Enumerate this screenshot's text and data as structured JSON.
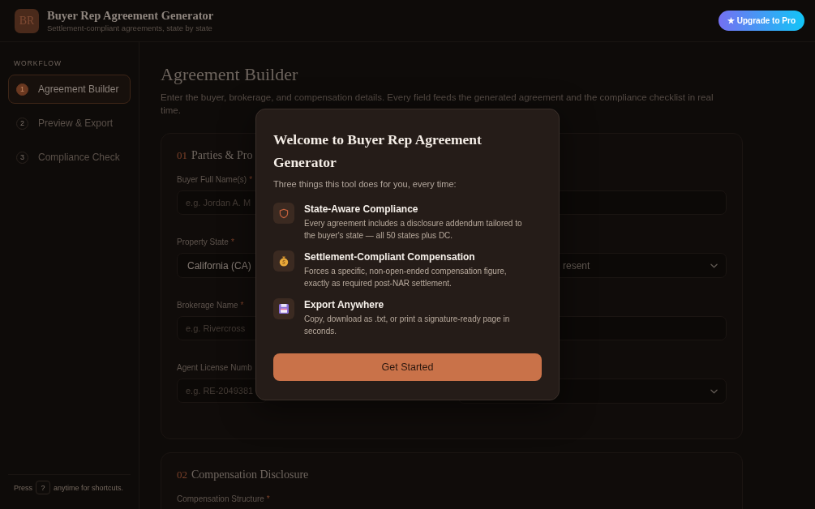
{
  "header": {
    "logo": "BR",
    "title": "Buyer Rep Agreement Generator",
    "subtitle": "Settlement-compliant agreements, state by state",
    "upgrade_button": "★ Upgrade to Pro"
  },
  "sidebar": {
    "heading": "WORKFLOW",
    "items": [
      {
        "number": "1",
        "label": "Agreement Builder",
        "selected": true
      },
      {
        "number": "2",
        "label": "Preview & Export",
        "selected": false
      },
      {
        "number": "3",
        "label": "Compliance Check",
        "selected": false
      }
    ],
    "footer": {
      "before": "Press",
      "key": "?",
      "after": "anytime for shortcuts."
    }
  },
  "main": {
    "title": "Agreement Builder",
    "description": "Enter the buyer, brokerage, and compensation details. Every field feeds the generated agreement and the compliance checklist in real time.",
    "sections": [
      {
        "number": "01",
        "title": "Parties & Pro",
        "fields": [
          {
            "kind": "input",
            "label": "Buyer Full Name(s)",
            "required_mark": "*",
            "placeholder": "e.g. Jordan A. M"
          },
          {
            "kind": "input"
          },
          {
            "kind": "select",
            "label": "Property State",
            "required_mark": "*",
            "value": "California (CA)"
          },
          {
            "kind": "select",
            "value": "resent",
            "caret": true
          },
          {
            "kind": "input",
            "label": "Brokerage Name",
            "required_mark": "*",
            "placeholder": "e.g. Rivercross"
          },
          {
            "kind": "input"
          },
          {
            "kind": "input",
            "label": "Agent License Numb",
            "placeholder": "e.g. RE-2049381"
          },
          {
            "kind": "select",
            "caret": true
          }
        ]
      },
      {
        "number": "02",
        "title": "Compensation Disclosure",
        "fields": [
          {
            "label": "Compensation Structure",
            "required_mark": "*"
          }
        ]
      }
    ]
  },
  "modal": {
    "title": "Welcome to Buyer Rep Agreement Generator",
    "intro": "Three things this tool does for you, every time:",
    "features": [
      {
        "title": "State-Aware Compliance",
        "text": "Every agreement includes a disclosure addendum tailored to the buyer's state — all 50 states plus DC."
      },
      {
        "title": "Settlement-Compliant Compensation",
        "text": "Forces a specific, non-open-ended compensation figure, exactly as required post-NAR settlement."
      },
      {
        "title": "Export Anywhere",
        "text": "Copy, download as .txt, or print a signature-ready page in seconds."
      }
    ],
    "button": "Get Started"
  }
}
